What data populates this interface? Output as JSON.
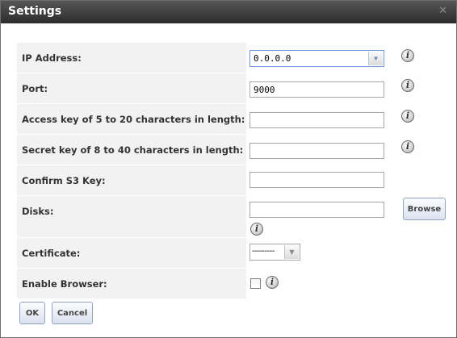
{
  "dialog": {
    "title": "Settings",
    "close_glyph": "✕"
  },
  "form": {
    "ip_address": {
      "label": "IP Address:",
      "value": "0.0.0.0",
      "info_icon": "i"
    },
    "port": {
      "label": "Port:",
      "value": "9000",
      "info_icon": "i"
    },
    "access_key": {
      "label": "Access key of 5 to 20 characters in length:",
      "value": "",
      "info_icon": "i"
    },
    "secret_key": {
      "label": "Secret key of 8 to 40 characters in length:",
      "value": "",
      "info_icon": "i"
    },
    "confirm_s3_key": {
      "label": "Confirm S3 Key:",
      "value": ""
    },
    "disks": {
      "label": "Disks:",
      "value": "",
      "browse_label": "Browse",
      "info_icon": "i"
    },
    "certificate": {
      "label": "Certificate:",
      "value": "---------"
    },
    "enable_browser": {
      "label": "Enable Browser:",
      "checked": false,
      "info_icon": "i"
    }
  },
  "buttons": {
    "ok": "OK",
    "cancel": "Cancel"
  },
  "colors": {
    "titlebar": "#3a3a3a",
    "label_bg": "#f2f2f2",
    "button_border": "#8ea3c2"
  }
}
